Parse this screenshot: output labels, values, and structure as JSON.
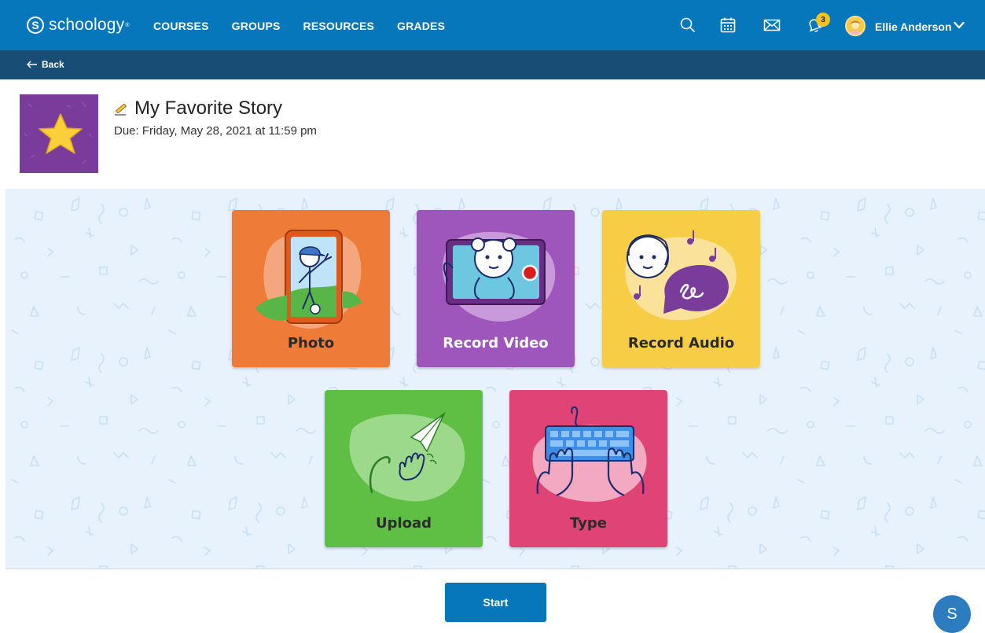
{
  "nav": {
    "logo": "schoology",
    "logo_mark": "S",
    "logo_tm": "®",
    "links": [
      "COURSES",
      "GROUPS",
      "RESOURCES",
      "GRADES"
    ],
    "notification_count": "3",
    "user_name": "Ellie Anderson",
    "icons": [
      "search-icon",
      "calendar-icon",
      "mail-icon",
      "bell-icon",
      "chevron-down-icon"
    ]
  },
  "backbar": {
    "label": "Back"
  },
  "assignment": {
    "title": "My Favorite Story",
    "due": "Due: Friday, May 28, 2021 at 11:59 pm"
  },
  "options": [
    {
      "label": "Photo",
      "color": "#ef7b38"
    },
    {
      "label": "Record Video",
      "color": "#9e56bd"
    },
    {
      "label": "Record Audio",
      "color": "#f8cd46"
    },
    {
      "label": "Upload",
      "color": "#5fbf45"
    },
    {
      "label": "Type",
      "color": "#e04476"
    }
  ],
  "footer": {
    "start_label": "Start",
    "fab_label": "S"
  },
  "colors": {
    "nav": "#0677ba",
    "backbar": "#184d76",
    "pattern_bg": "#e7f2fc"
  }
}
